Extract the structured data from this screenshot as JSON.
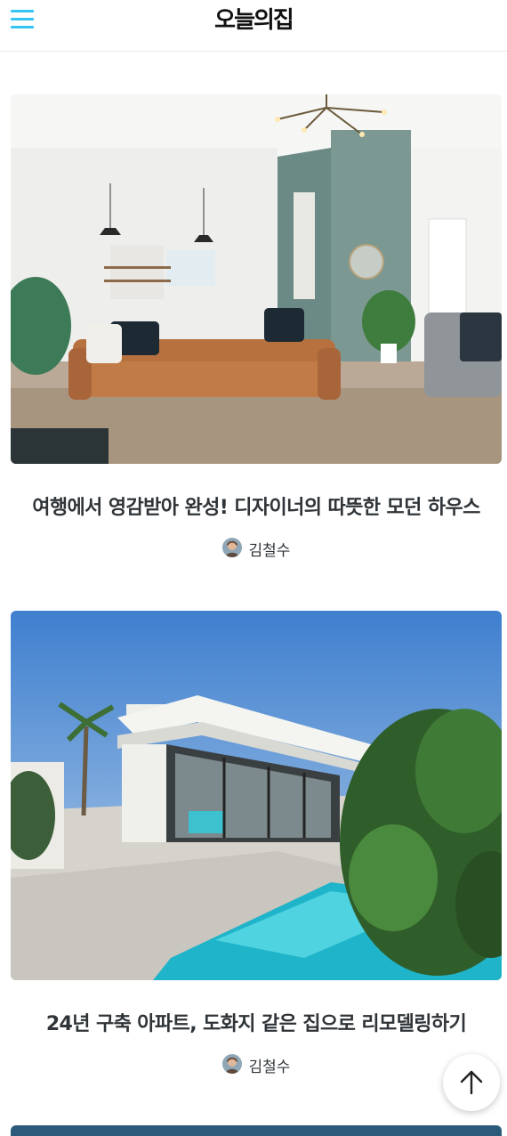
{
  "header": {
    "logo": "오늘의집",
    "menu_icon": "hamburger-menu-icon",
    "accent": "#35c5f0"
  },
  "cards": [
    {
      "title": "여행에서 영감받아 완성! 디자이너의 따뜻한 모던 하우스",
      "author": "김철수",
      "image": "living-room-photo"
    },
    {
      "title": "24년 구축 아파트, 도화지 같은 집으로 리모델링하기",
      "author": "김철수",
      "image": "pool-house-photo"
    }
  ],
  "scroll_top_icon": "arrow-up-icon"
}
